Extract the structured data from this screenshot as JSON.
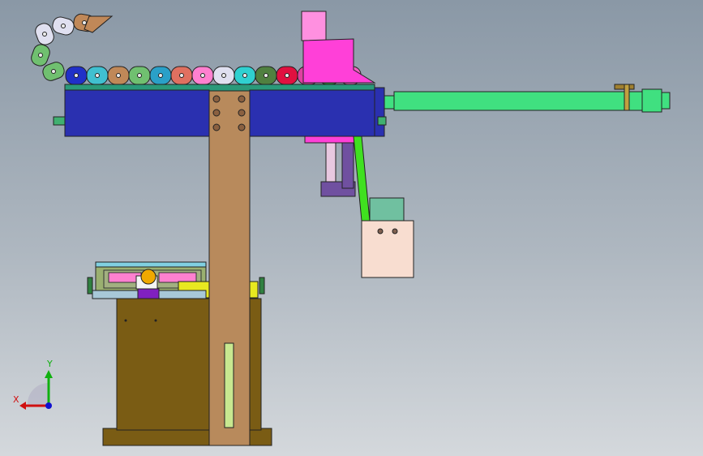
{
  "viewport": {
    "background_top": "#8a98a6",
    "background_bottom": "#d4d8dc"
  },
  "triad": {
    "x_label": "X",
    "y_label": "Y",
    "x_color": "#d01010",
    "y_color": "#10b010",
    "z_color": "#1010d0"
  },
  "parts": {
    "cable_chain_colors": [
      "#2030c8",
      "#40c0d0",
      "#c08858",
      "#70c070",
      "#2aa0c8",
      "#e07060",
      "#ff80d0",
      "#e0e0f0",
      "#30d0d0",
      "#508040",
      "#e01040",
      "#e040a0",
      "#30a040",
      "#f060c0"
    ],
    "beam_color": "#2a30b0",
    "column_color": "#b88a5c",
    "base_color": "#7a5c14",
    "cylinder_color": "#40e080",
    "motor_color": "#ff40d8",
    "gripper_color": "#f8ddd0"
  }
}
